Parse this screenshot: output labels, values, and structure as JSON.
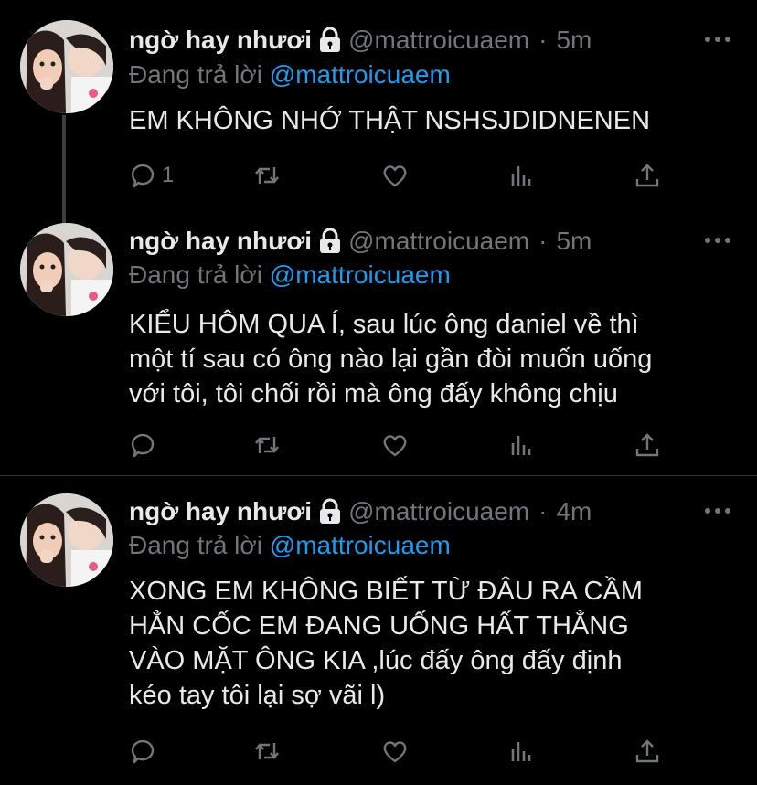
{
  "tweets": [
    {
      "name": "ngờ hay nhươi",
      "handle": "@mattroicuaem",
      "dot": "·",
      "time": "5m",
      "reply_prefix": "Đang trả lời",
      "reply_mention": "@mattroicuaem",
      "lines": [
        "EM KHÔNG NHỚ THẬT NSHSJDIDNENEN"
      ],
      "reply_count": "1"
    },
    {
      "name": "ngờ hay nhươi",
      "handle": "@mattroicuaem",
      "dot": "·",
      "time": "5m",
      "reply_prefix": "Đang trả lời",
      "reply_mention": "@mattroicuaem",
      "lines": [
        "KIỂU HÔM QUA Í, sau lúc ông daniel về thì",
        "một tí sau có ông nào lại gần đòi muốn uống",
        "với tôi, tôi chối rồi mà ông đấy không chịu"
      ],
      "reply_count": ""
    },
    {
      "name": "ngờ hay nhươi",
      "handle": "@mattroicuaem",
      "dot": "·",
      "time": "4m",
      "reply_prefix": "Đang trả lời",
      "reply_mention": "@mattroicuaem",
      "lines": [
        "XONG EM KHÔNG BIẾT TỪ ĐÂU RA CẦM",
        "HẲN CỐC EM ĐANG UỐNG HẤT THẲNG",
        "VÀO MẶT ÔNG KIA ,lúc đấy ông đấy định",
        "kéo tay tôi lại sợ vãi l)"
      ],
      "reply_count": ""
    }
  ],
  "icons": {
    "verified_lock": "lock-icon",
    "more": "more-options-icon",
    "reply": "reply-icon",
    "retweet": "retweet-icon",
    "like": "like-icon",
    "views": "views-icon",
    "share": "share-icon"
  },
  "colors": {
    "background": "#000000",
    "text": "#e7e9ea",
    "secondary": "#71767b",
    "accent": "#1d9bf0"
  }
}
